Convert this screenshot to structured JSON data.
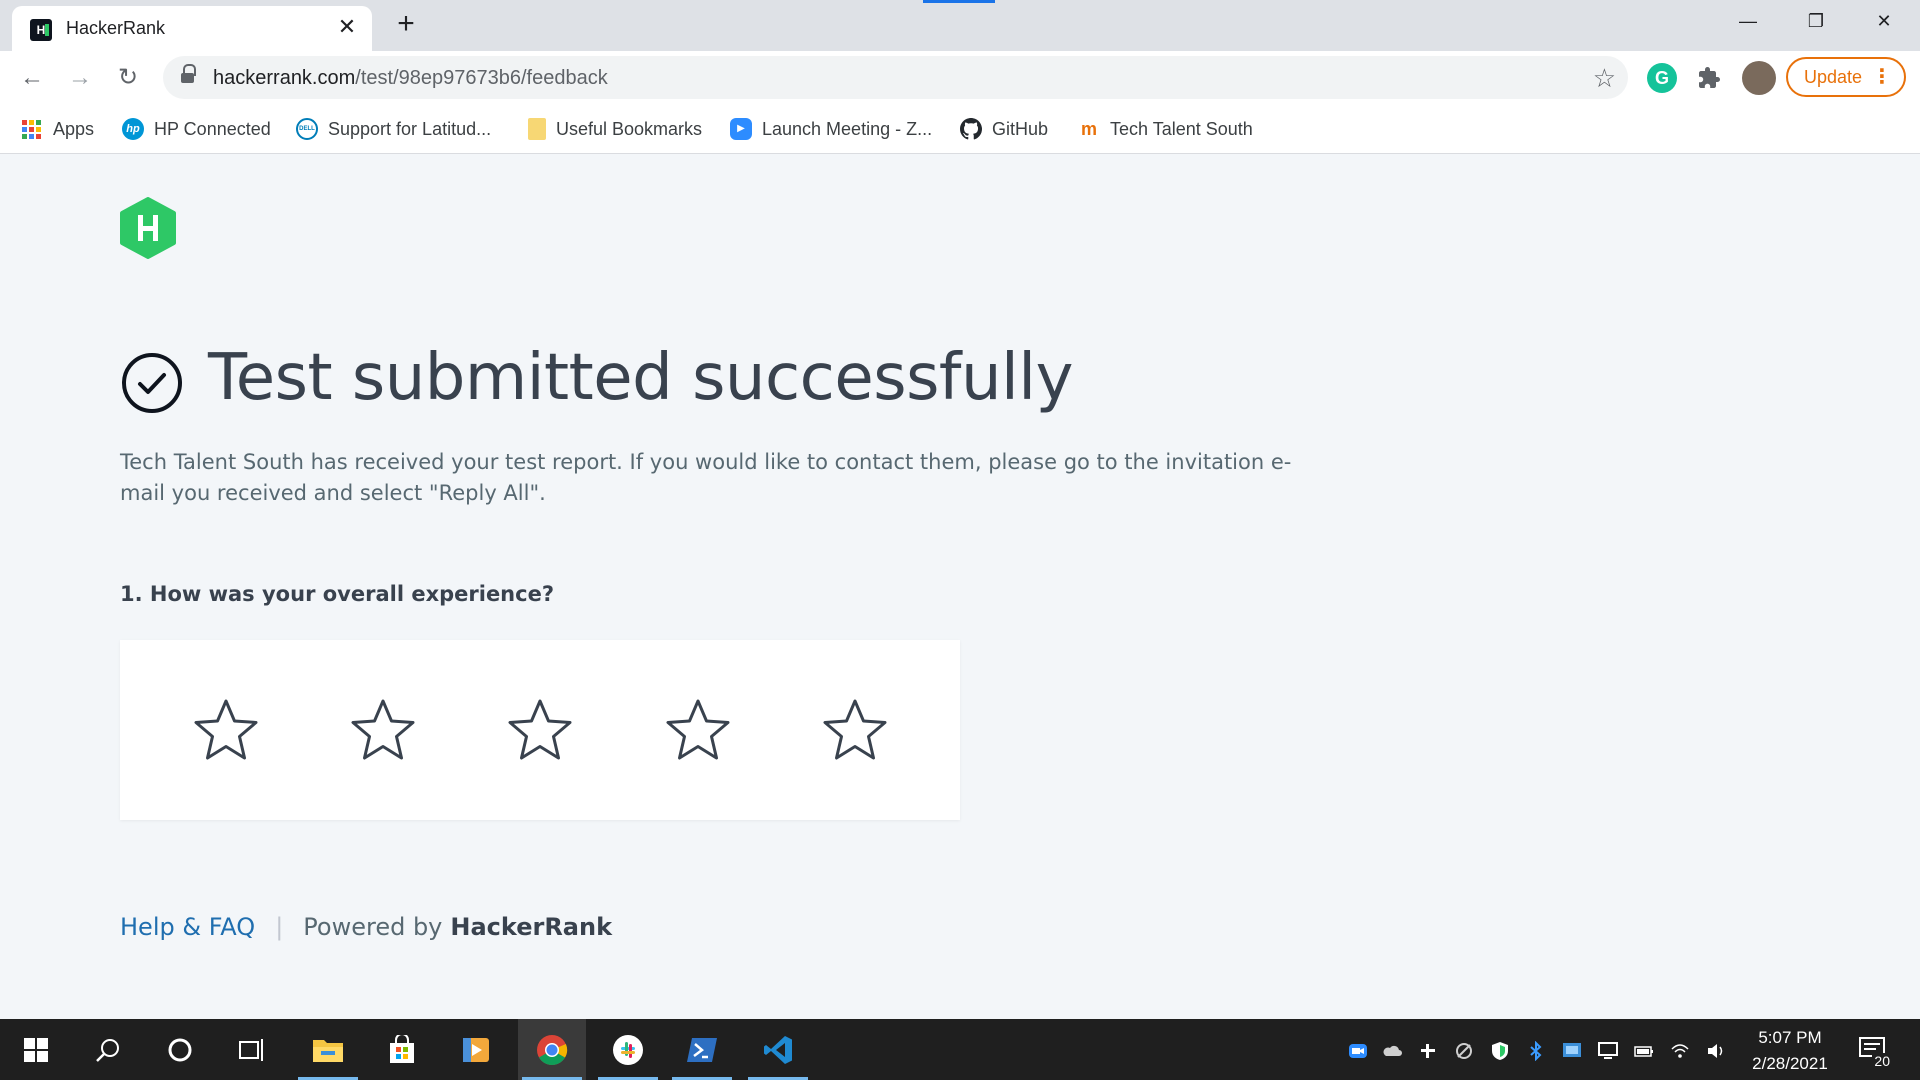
{
  "browser": {
    "tab": {
      "title": "HackerRank",
      "favicon_label": "H"
    },
    "new_tab_label": "+",
    "window_controls": {
      "minimize": "—",
      "restore": "❐",
      "close": "✕"
    },
    "nav": {
      "back": "←",
      "forward": "→",
      "reload": "↻"
    },
    "address": {
      "host": "hackerrank.com",
      "path": "/test/98ep97673b6/feedback"
    },
    "extensions": {
      "grammarly": "G",
      "puzzle": "✦"
    },
    "update_label": "Update",
    "menu_dots": "⋮",
    "bookmarks": [
      {
        "label": "Apps",
        "icon": "apps-grid-icon"
      },
      {
        "label": "HP Connected",
        "icon": "hp-icon",
        "glyph": "hp"
      },
      {
        "label": "Support for Latitud...",
        "icon": "dell-icon",
        "glyph": "DELL"
      },
      {
        "label": "Useful Bookmarks",
        "icon": "folder-icon",
        "glyph": ""
      },
      {
        "label": "Launch Meeting - Z...",
        "icon": "zoom-icon",
        "glyph": "▶"
      },
      {
        "label": "GitHub",
        "icon": "github-icon",
        "glyph": ""
      },
      {
        "label": "Tech Talent South",
        "icon": "tech-talent-south-icon",
        "glyph": "m"
      }
    ]
  },
  "page": {
    "heading": "Test submitted successfully",
    "message": "Tech Talent South has received your test report. If you would like to contact them, please go to the invitation e-mail you received and select \"Reply All\".",
    "question": "1. How was your overall experience?",
    "rating": {
      "selected": 0,
      "max": 5
    },
    "footer": {
      "help_link": "Help & FAQ",
      "separator": "|",
      "powered_by": "Powered by",
      "brand": "HackerRank"
    }
  },
  "taskbar": {
    "clock_time": "5:07 PM",
    "clock_date": "2/28/2021",
    "notification_count": "20"
  },
  "colors": {
    "hackerrank_green": "#2ec866",
    "page_background": "#f3f6f9",
    "heading_text": "#39424e",
    "link_blue": "#1f6eaf",
    "update_orange": "#e8710a",
    "taskbar": "#1f1f1f"
  }
}
